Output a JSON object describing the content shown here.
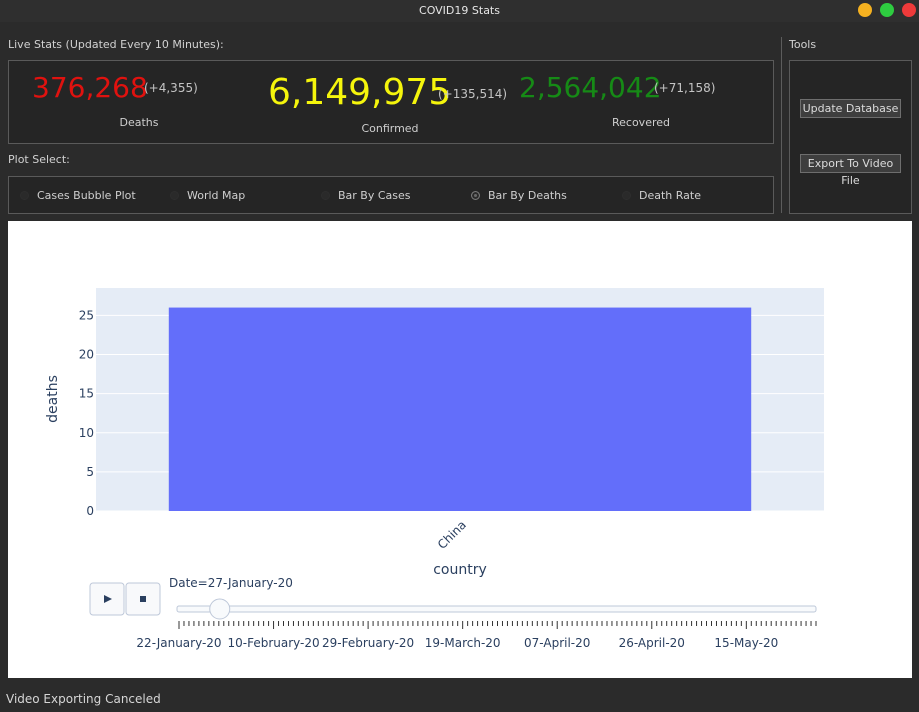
{
  "window": {
    "title": "COVID19 Stats",
    "controls": {
      "minimize_color": "#f5b120",
      "maximize_color": "#2ecc40",
      "close_color": "#ee3a3a"
    }
  },
  "live_stats": {
    "label": "Live Stats (Updated Every 10 Minutes):",
    "deaths": {
      "value": "376,268",
      "delta": "(+4,355)",
      "caption": "Deaths",
      "color": "#e0120f"
    },
    "confirmed": {
      "value": "6,149,975",
      "delta": "(+135,514)",
      "caption": "Confirmed",
      "color": "#f5f50c"
    },
    "recovered": {
      "value": "2,564,042",
      "delta": "(+71,158)",
      "caption": "Recovered",
      "color": "#168a16"
    }
  },
  "plot_select": {
    "label": "Plot Select:",
    "options": [
      {
        "label": "Cases Bubble Plot",
        "selected": false
      },
      {
        "label": "World Map",
        "selected": false
      },
      {
        "label": "Bar By Cases",
        "selected": false
      },
      {
        "label": "Bar By Deaths",
        "selected": true
      },
      {
        "label": "Death Rate",
        "selected": false
      }
    ]
  },
  "tools": {
    "label": "Tools",
    "update_database": "Update Database",
    "export_video": "Export To Video File"
  },
  "chart_data": {
    "type": "bar",
    "categories": [
      "China"
    ],
    "values": [
      26
    ],
    "xlabel": "country",
    "ylabel": "deaths",
    "ylim": [
      0,
      28.5
    ],
    "yticks": [
      0,
      5,
      10,
      15,
      20,
      25
    ],
    "bar_color": "#636efa",
    "plot_bg": "#e5ecf6",
    "grid": true
  },
  "animation": {
    "current_label": "Date=27-January-20",
    "play_icon": "play-icon",
    "stop_icon": "stop-icon",
    "slider_position": 0.05,
    "date_ticks": [
      "22-January-20",
      "10-February-20",
      "29-February-20",
      "19-March-20",
      "07-April-20",
      "26-April-20",
      "15-May-20"
    ]
  },
  "status": {
    "message": "Video Exporting Canceled"
  }
}
